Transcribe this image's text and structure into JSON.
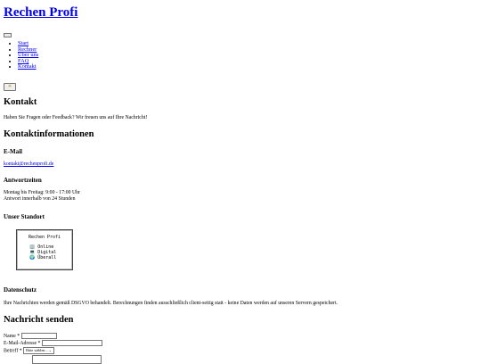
{
  "site": {
    "title": "Rechen Profi"
  },
  "nav": {
    "items": [
      {
        "label": "Start"
      },
      {
        "label": "Rechner"
      },
      {
        "label": "Über uns"
      },
      {
        "label": "FAQ"
      },
      {
        "label": "Kontakt"
      }
    ],
    "theme_toggle_icon": "sun-moon-icon"
  },
  "contact": {
    "heading": "Kontakt",
    "intro": "Haben Sie Fragen oder Feedback? Wir freuen uns auf Ihre Nachricht!",
    "info_heading": "Kontaktinformationen",
    "email_heading": "E-Mail",
    "email": "kontakt@rechenprofi.de",
    "hours_heading": "Antwortzeiten",
    "hours_line1": "Montag bis Freitag: 9:00 - 17:00 Uhr",
    "hours_line2": "Antwort innerhalb von 24 Stunden",
    "location_heading": "Unser Standort",
    "map": {
      "title": "Rechen Profi",
      "line1": "🏢 Online",
      "line2": "💻 Digital",
      "line3": "🌍 Überall"
    },
    "privacy_heading": "Datenschutz",
    "privacy_text": "Ihre Nachrichten werden gemäß DSGVO behandelt. Berechnungen finden ausschließlich client-seitig statt - keine Daten werden auf unseren Servern gespeichert."
  },
  "form": {
    "heading": "Nachricht senden",
    "name_label": "Name *",
    "email_label": "E-Mail-Adresse *",
    "subject_label": "Betreff *",
    "subject_selected": "Bitte wählen..."
  }
}
